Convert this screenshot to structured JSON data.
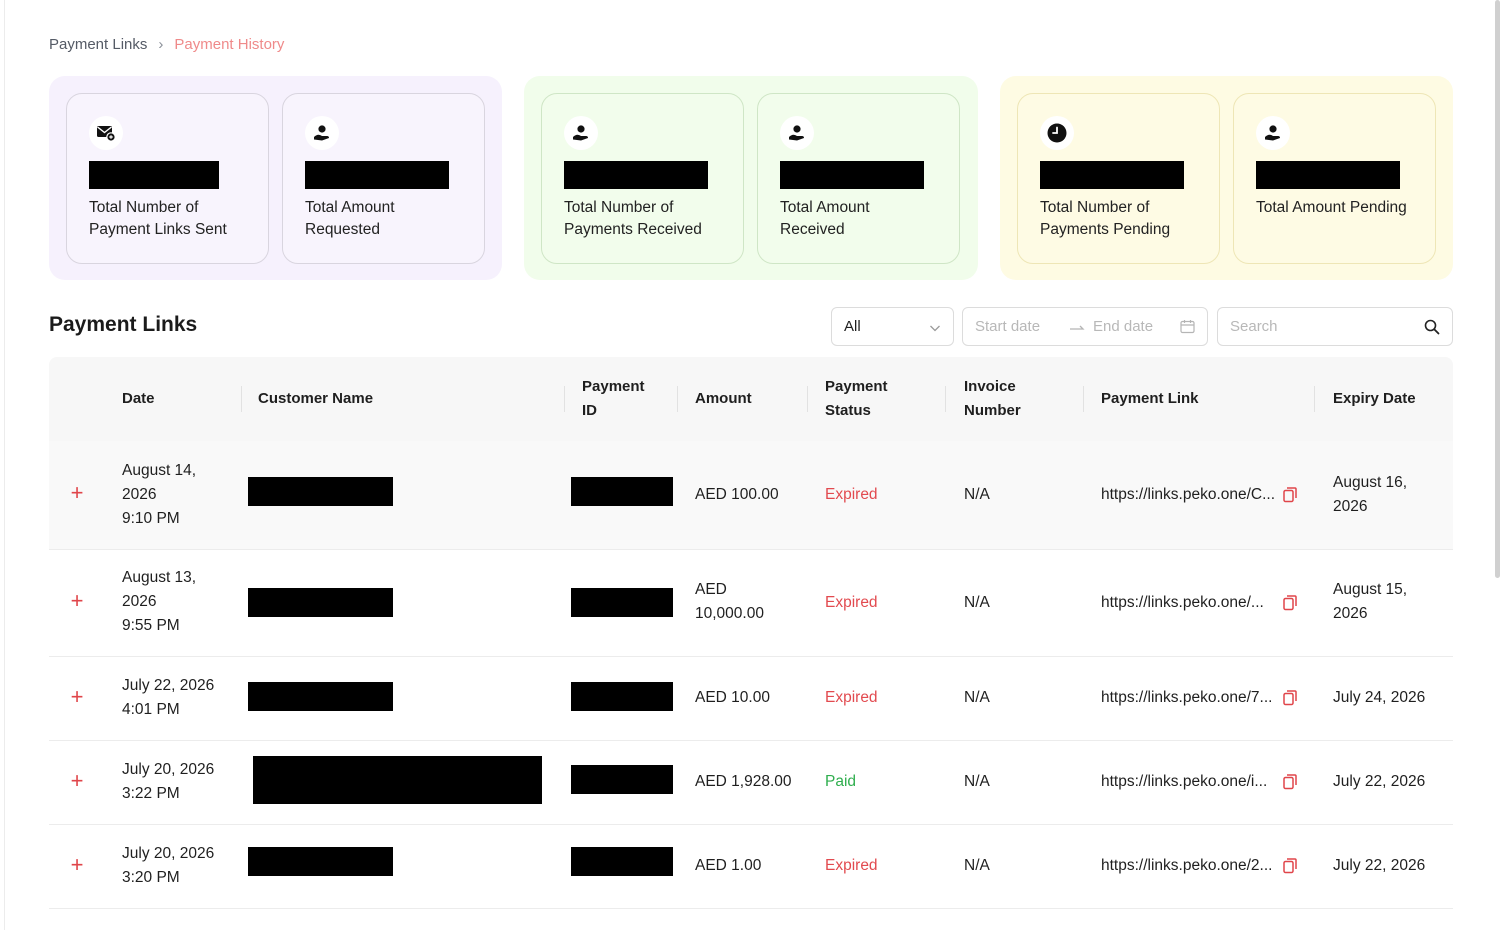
{
  "breadcrumb": {
    "root": "Payment Links",
    "separator": "›",
    "current": "Payment History"
  },
  "summary": {
    "purple": [
      {
        "label_1": "Total Number of",
        "label_2": "Payment Links Sent",
        "icon": "mail-send-icon"
      },
      {
        "label_1": "Total Amount",
        "label_2": "Requested",
        "icon": "hand-money-icon"
      }
    ],
    "green": [
      {
        "label_1": "Total Number of",
        "label_2": "Payments Received",
        "icon": "hand-money-icon"
      },
      {
        "label_1": "Total Amount",
        "label_2": "Received",
        "icon": "hand-money-icon"
      }
    ],
    "yellow": [
      {
        "label_1": "Total Number of",
        "label_2": "Payments Pending",
        "icon": "clock-icon"
      },
      {
        "label_1": "Total Amount Pending",
        "label_2": "",
        "icon": "hand-money-icon"
      }
    ]
  },
  "section": {
    "title": "Payment Links"
  },
  "filters": {
    "status_selected": "All",
    "start_placeholder": "Start date",
    "end_placeholder": "End date",
    "search_placeholder": "Search"
  },
  "table": {
    "columns": {
      "date": "Date",
      "customer": "Customer Name",
      "payment_id_1": "Payment",
      "payment_id_2": "ID",
      "amount": "Amount",
      "status_1": "Payment",
      "status_2": "Status",
      "invoice_1": "Invoice",
      "invoice_2": "Number",
      "link": "Payment Link",
      "expiry": "Expiry Date"
    },
    "rows": [
      {
        "date_1": "August 14,",
        "date_2": "2026",
        "date_3": "9:10 PM",
        "amount_1": "AED 100.00",
        "amount_2": "",
        "status": "Expired",
        "invoice": "N/A",
        "link": "https://links.peko.one/C...",
        "expiry_1": "August 16,",
        "expiry_2": "2026"
      },
      {
        "date_1": "August 13,",
        "date_2": "2026",
        "date_3": "9:55 PM",
        "amount_1": "AED",
        "amount_2": "10,000.00",
        "status": "Expired",
        "invoice": "N/A",
        "link": "https://links.peko.one/...",
        "expiry_1": "August 15,",
        "expiry_2": "2026"
      },
      {
        "date_1": "July 22, 2026",
        "date_2": "4:01 PM",
        "date_3": "",
        "amount_1": "AED 10.00",
        "amount_2": "",
        "status": "Expired",
        "invoice": "N/A",
        "link": "https://links.peko.one/7...",
        "expiry_1": "July 24, 2026",
        "expiry_2": ""
      },
      {
        "date_1": "July 20, 2026",
        "date_2": "3:22 PM",
        "date_3": "",
        "amount_1": "AED 1,928.00",
        "amount_2": "",
        "status": "Paid",
        "invoice": "N/A",
        "link": "https://links.peko.one/i...",
        "expiry_1": "July 22, 2026",
        "expiry_2": ""
      },
      {
        "date_1": "July 20, 2026",
        "date_2": "3:20 PM",
        "date_3": "",
        "amount_1": "AED 1.00",
        "amount_2": "",
        "status": "Expired",
        "invoice": "N/A",
        "link": "https://links.peko.one/2...",
        "expiry_1": "July 22, 2026",
        "expiry_2": ""
      }
    ]
  },
  "colors": {
    "accent_red": "#e24a4f",
    "paid_green": "#2fae4e",
    "breadcrumb_active": "#ef8a8a"
  }
}
